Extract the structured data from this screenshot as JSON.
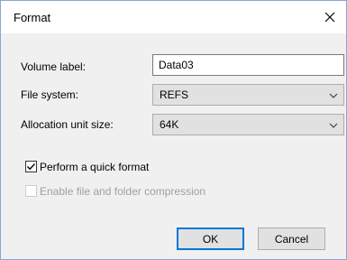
{
  "dialog": {
    "title": "Format",
    "fields": {
      "volume_label": {
        "label": "Volume label:",
        "value": "Data03"
      },
      "file_system": {
        "label": "File system:",
        "selected": "REFS"
      },
      "allocation_unit": {
        "label": "Allocation unit size:",
        "selected": "64K"
      }
    },
    "options": {
      "quick_format": {
        "label": "Perform a quick format",
        "checked": true
      },
      "compression": {
        "label": "Enable file and folder compression",
        "checked": false,
        "enabled": false
      }
    },
    "buttons": {
      "ok": "OK",
      "cancel": "Cancel"
    }
  },
  "icons": {
    "close": "close-icon",
    "dropdown": "chevron-down-icon",
    "check": "checkmark-icon"
  },
  "colors": {
    "accent": "#0078d7",
    "dialog_bg": "#f0f0f0",
    "disabled_text": "#a0a0a0"
  }
}
